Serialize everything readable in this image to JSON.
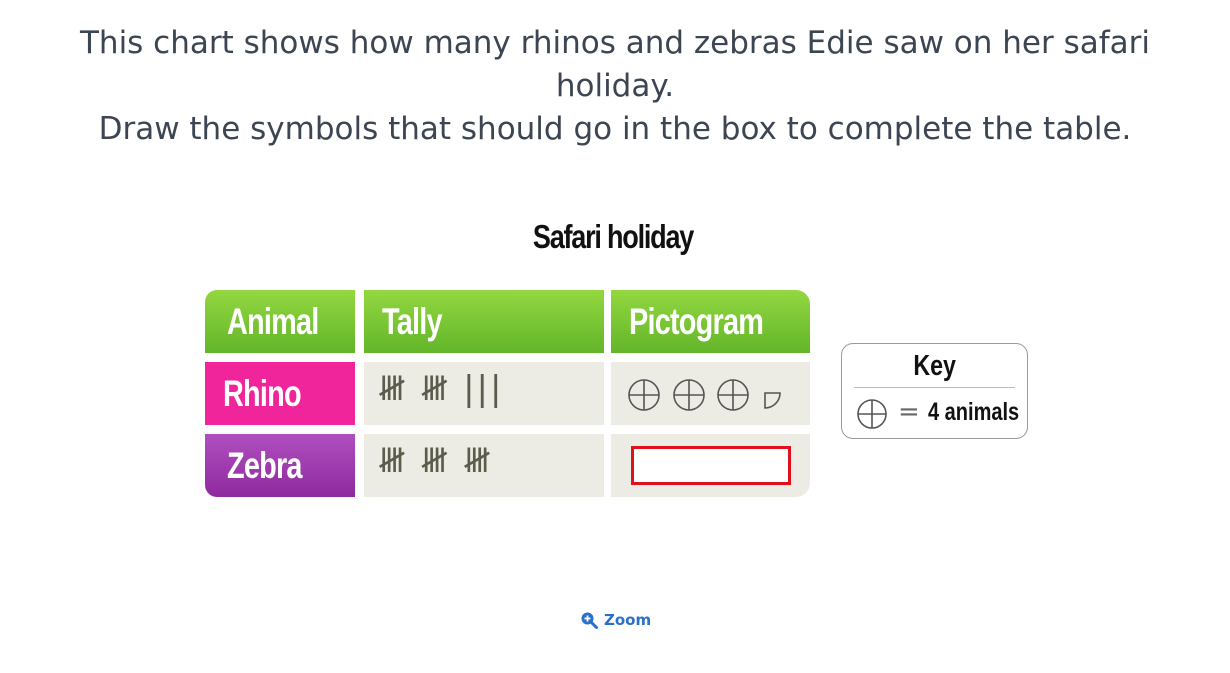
{
  "question": {
    "line1": "This chart shows how many rhinos and zebras Edie saw on her safari holiday.",
    "line2": "Draw the symbols that should go in the box to complete the table."
  },
  "table": {
    "title": "Safari holiday",
    "headers": [
      "Animal",
      "Tally",
      "Pictogram"
    ],
    "rows": [
      {
        "animal": "Rhino",
        "tally": "𝍸 𝍸 |||",
        "tally_count": 13,
        "pictogram": {
          "full_symbols": 3,
          "partial": "quarter"
        }
      },
      {
        "animal": "Zebra",
        "tally": "𝍸 𝍸 𝍸",
        "tally_count": 15,
        "pictogram": {
          "answer_box": "empty"
        }
      }
    ]
  },
  "key": {
    "title": "Key",
    "equals": "=",
    "value": "4 animals",
    "symbol_icon": "circle-cross-icon"
  },
  "zoom": {
    "label": "Zoom",
    "icon": "zoom-in-icon"
  },
  "colors": {
    "header_green": "#7cc735",
    "rhino_pink": "#f0259b",
    "zebra_purple": "#a03bb2",
    "cell_bg": "#ecebe4",
    "answer_border": "#e0111c",
    "link_blue": "#2a6fc9"
  }
}
